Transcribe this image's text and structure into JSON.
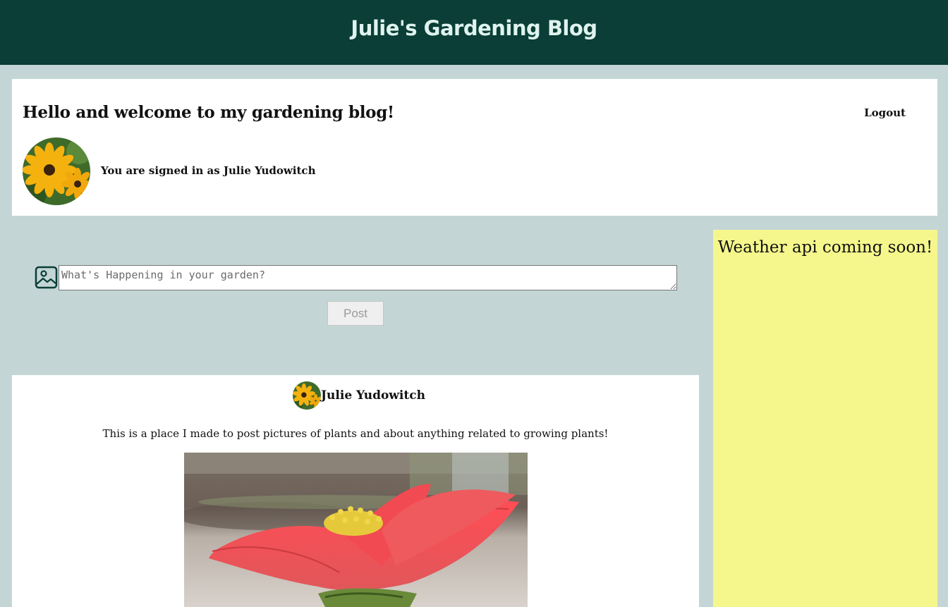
{
  "header": {
    "site_title": "Julie's Gardening Blog"
  },
  "welcome": {
    "heading": "Hello and welcome to my gardening blog!",
    "logout_label": "Logout",
    "signed_in_text": "You are signed in as Julie Yudowitch"
  },
  "composer": {
    "placeholder": "What's Happening in your garden?",
    "value": "",
    "post_label": "Post",
    "icon": "image-icon"
  },
  "weather": {
    "text": "Weather api coming soon!"
  },
  "posts": [
    {
      "author": "Julie Yudowitch",
      "text": "This is a place I made to post pictures of plants and about anything related to growing plants!",
      "image": "red-zinnia-flower-photo"
    }
  ],
  "colors": {
    "header_bg": "#0a3e36",
    "page_bg": "#c3d6d5",
    "weather_bg": "#f5f78c",
    "title_text": "#dff3ef"
  }
}
